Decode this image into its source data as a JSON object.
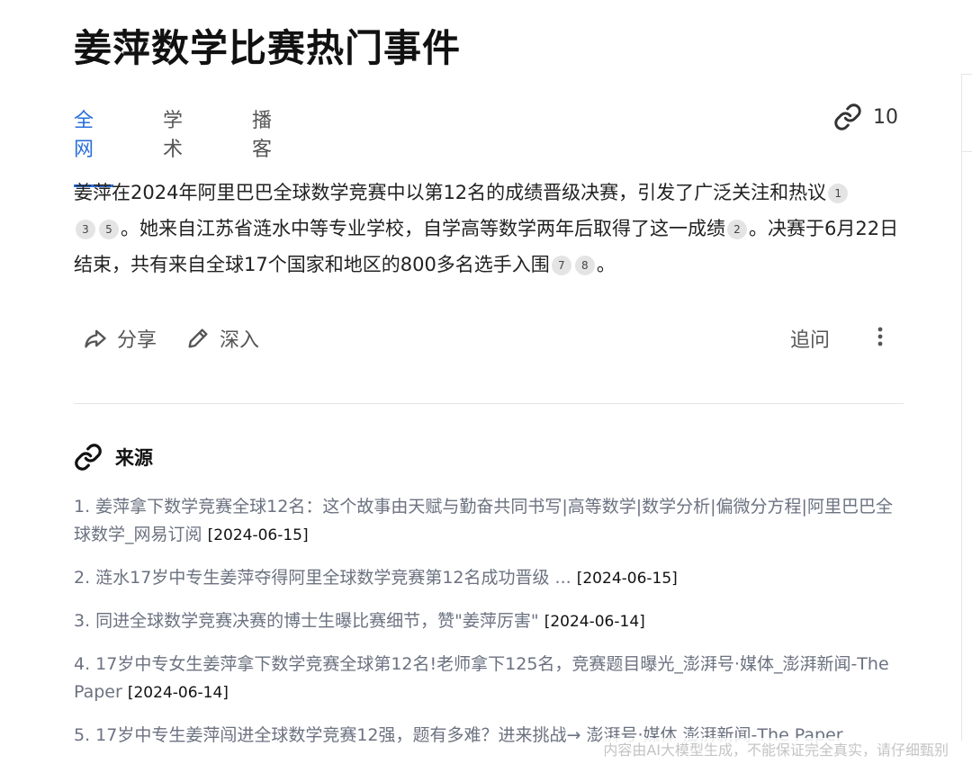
{
  "page": {
    "title": "姜萍数学比赛热门事件"
  },
  "tabs": [
    {
      "label": "全网",
      "active": true
    },
    {
      "label": "学术"
    },
    {
      "label": "播客"
    }
  ],
  "link_count": {
    "icon": "link-icon",
    "value": "10"
  },
  "summary": {
    "part1": "姜萍在2024年阿里巴巴全球数学竞赛中以第12名的成绩晋级决赛，引发了广泛关注和热议",
    "cites1": [
      "1",
      "3",
      "5"
    ],
    "part2": "。她来自江苏省涟水中等专业学校，自学高等数学两年后取得了这一成绩",
    "cites2": [
      "2"
    ],
    "part3": "。决赛于6月22日结束，共有来自全球17个国家和地区的800多名选手入围",
    "cites3": [
      "7",
      "8"
    ],
    "part4": "。"
  },
  "actions": {
    "share": "分享",
    "deep": "深入",
    "followup": "追问"
  },
  "sources": {
    "heading": "来源",
    "items": [
      {
        "title": "1. 姜萍拿下数学竞赛全球12名：这个故事由天赋与勤奋共同书写|高等数学|数学分析|偏微分方程|阿里巴巴全球数学_网易订阅",
        "date": "[2024-06-15]"
      },
      {
        "title": "2. 涟水17岁中专生姜萍夺得阿里全球数学竞赛第12名成功晋级 ...",
        "date": "[2024-06-15]"
      },
      {
        "title": "3. 同进全球数学竞赛决赛的博士生曝比赛细节，赞\"姜萍厉害\"",
        "date": "[2024-06-14]"
      },
      {
        "title": "4. 17岁中专女生姜萍拿下数学竞赛全球第12名!老师拿下125名，竞赛题目曝光_澎湃号·媒体_澎湃新闻-The Paper",
        "date": "[2024-06-14]"
      },
      {
        "title": "5. 17岁中专生姜萍闯进全球数学竞赛12强，题有多难？进来挑战→  澎湃号·媒体  澎湃新闻-The Paper",
        "date": ""
      }
    ]
  },
  "footer_note": "内容由AI大模型生成，不能保证完全真实，请仔细甄别",
  "colors": {
    "accent": "#2a6fdb",
    "text": "#222222",
    "muted": "#6b7280"
  }
}
